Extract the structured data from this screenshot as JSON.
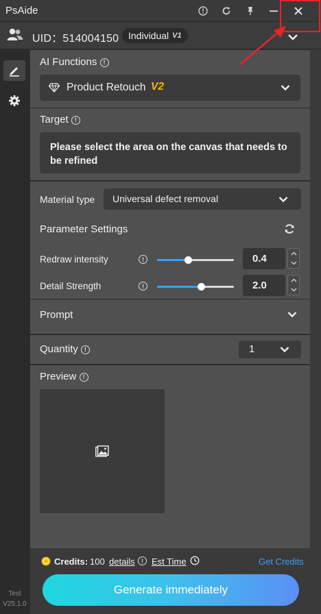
{
  "app": {
    "title": "PsAide"
  },
  "user": {
    "uid_text": "UID：514004150",
    "plan": "Individual",
    "plan_version": "V1"
  },
  "ai_functions": {
    "label": "AI Functions",
    "selected": "Product Retouch",
    "selected_badge": "V2"
  },
  "target": {
    "label": "Target",
    "message": "Please select the area on the canvas that needs to be refined"
  },
  "material": {
    "label": "Material type",
    "selected": "Universal defect removal"
  },
  "parameters": {
    "label": "Parameter Settings",
    "redraw": {
      "label": "Redraw intensity",
      "value": "0.4",
      "fraction": 0.4
    },
    "detail": {
      "label": "Detail Strength",
      "value": "2.0",
      "fraction": 0.57
    }
  },
  "prompt": {
    "label": "Prompt"
  },
  "quantity": {
    "label": "Quantity",
    "value": "1"
  },
  "preview": {
    "label": "Preview"
  },
  "footer": {
    "credits_label": "Credits:",
    "credits_value": "100",
    "details_link": "details",
    "est_time": "Est Time",
    "get_credits": "Get Credits",
    "generate_button": "Generate immediately"
  },
  "sidebar": {
    "version_env": "Test",
    "version": "V25.1.0"
  },
  "colors": {
    "accent_blue": "#37a0ff",
    "badge_gold": "#f5b800",
    "annotation_red": "#e8242a",
    "link_blue": "#3a9ff0"
  }
}
